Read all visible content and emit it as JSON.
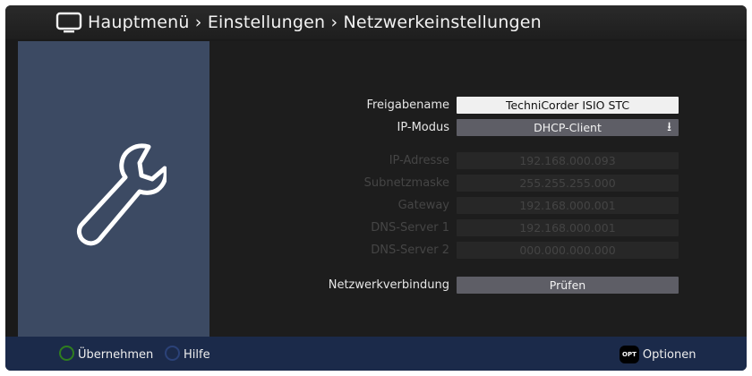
{
  "header": {
    "breadcrumb": "Hauptmenü › Einstellungen › Netzwerkeinstellungen"
  },
  "form": {
    "freigabename": {
      "label": "Freigabename",
      "value": "TechniCorder ISIO STC"
    },
    "ip_modus": {
      "label": "IP-Modus",
      "value": "DHCP-Client"
    },
    "ip_adresse": {
      "label": "IP-Adresse",
      "value": "192.168.000.093"
    },
    "subnetzmaske": {
      "label": "Subnetzmaske",
      "value": "255.255.255.000"
    },
    "gateway": {
      "label": "Gateway",
      "value": "192.168.000.001"
    },
    "dns1": {
      "label": "DNS-Server 1",
      "value": "192.168.000.001"
    },
    "dns2": {
      "label": "DNS-Server 2",
      "value": "000.000.000.000"
    },
    "netzwerkverbindung": {
      "label": "Netzwerkverbindung",
      "value": "Prüfen"
    }
  },
  "footer": {
    "accept": "Übernehmen",
    "help": "Hilfe",
    "options_key": "OPT",
    "options": "Optionen"
  },
  "colors": {
    "side_panel": "#3c4a63",
    "footer": "#1b2a4a",
    "green_key": "#2f7d1f",
    "blue_key": "#2b4278"
  },
  "icons": {
    "title": "tv-icon",
    "panel": "wrench-icon",
    "dropdown": "dropdown-arrow-icon"
  }
}
